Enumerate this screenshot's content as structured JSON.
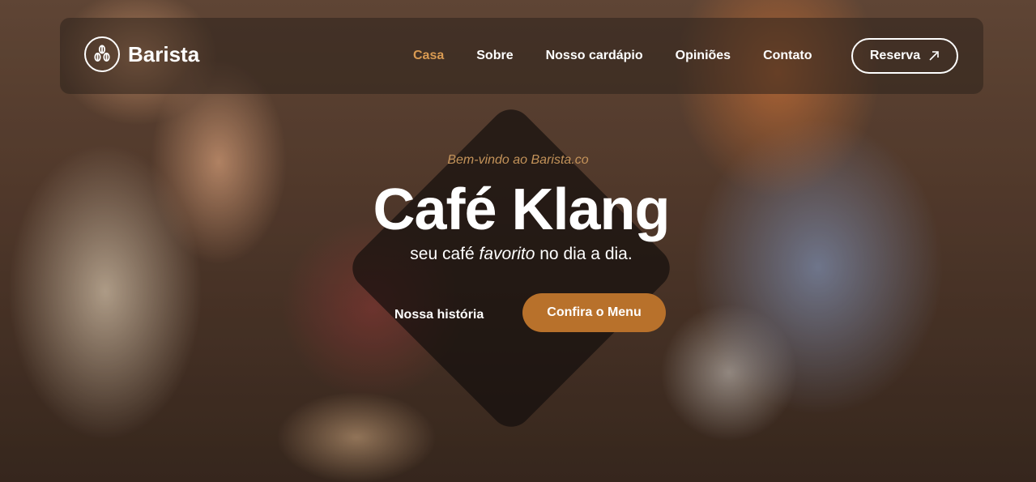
{
  "nav": {
    "brand": "Barista",
    "links": [
      "Casa",
      "Sobre",
      "Nosso cardápio",
      "Opiniões",
      "Contato"
    ],
    "active": "Casa",
    "reserve_label": "Reserva"
  },
  "hero": {
    "welcome": "Bem-vindo ao Barista.co",
    "title": "Café Klang",
    "subtitle_before": "seu café",
    "subtitle_emphasis": "favorito",
    "subtitle_after": "no dia a dia.",
    "story_label": "Nossa história",
    "menu_label": "Confira o Menu"
  },
  "colors": {
    "accent": "#d99a52",
    "button": "#b8712b",
    "welcome_text": "#c4935a"
  },
  "icons": {
    "logo": "coffee-beans-icon",
    "reserve": "arrow-up-right-icon"
  }
}
